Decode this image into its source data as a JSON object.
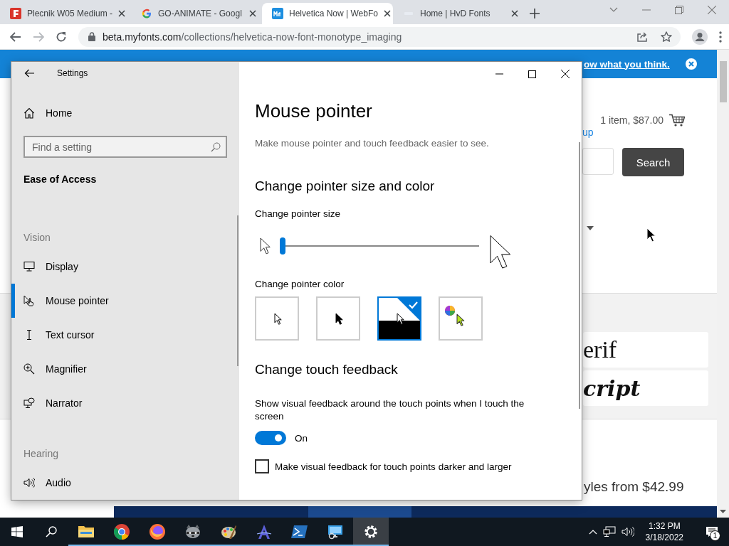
{
  "browser": {
    "tabs": [
      {
        "title": "Plecnik W05 Medium -",
        "kind": "letter-f",
        "selected": false
      },
      {
        "title": "GO-ANIMATE - Googl",
        "kind": "letter-g",
        "selected": false
      },
      {
        "title": "Helvetica Now | WebFo",
        "kind": "fonts",
        "selected": true
      },
      {
        "title": "Home | HvD Fonts",
        "kind": "blank",
        "selected": false
      }
    ],
    "address": {
      "host": "beta.myfonts.com",
      "path": "/collections/helvetica-now-font-monotype_imaging"
    }
  },
  "web_page": {
    "banner_link": "ow what you think.",
    "cart": "1 item, $87.00",
    "link": "up",
    "search_button": "Search",
    "font_cards": [
      {
        "text": "erif",
        "kind": "serif"
      },
      {
        "text": "cript",
        "kind": "script"
      }
    ],
    "price": "yles from $42.99"
  },
  "settings_window": {
    "title": "Settings",
    "nav": {
      "home": "Home",
      "search_placeholder": "Find a setting",
      "section": "Ease of Access",
      "groups": [
        {
          "heading": "Vision",
          "items": [
            {
              "label": "Display",
              "kind": "display",
              "selected": false
            },
            {
              "label": "Mouse pointer",
              "kind": "pointer",
              "selected": true
            },
            {
              "label": "Text cursor",
              "kind": "text-cursor",
              "selected": false
            },
            {
              "label": "Magnifier",
              "kind": "magnifier",
              "selected": false
            },
            {
              "label": "Narrator",
              "kind": "narrator",
              "selected": false
            }
          ]
        },
        {
          "heading": "Hearing",
          "items": [
            {
              "label": "Audio",
              "kind": "audio",
              "selected": false
            }
          ]
        }
      ]
    },
    "page": {
      "title": "Mouse pointer",
      "description": "Make mouse pointer and touch feedback easier to see.",
      "size_section": {
        "heading": "Change pointer size and color",
        "size_label": "Change pointer size",
        "size_slider": {
          "level": 0.0
        },
        "color_label": "Change pointer color",
        "color_options": [
          {
            "kind": "white",
            "selected": false
          },
          {
            "kind": "black",
            "selected": false
          },
          {
            "kind": "inverted",
            "selected": true
          },
          {
            "kind": "custom",
            "selected": false
          }
        ]
      },
      "touch_section": {
        "heading": "Change touch feedback",
        "toggle_label": "Show visual feedback around the touch points when I touch the screen",
        "toggle_on": true,
        "toggle_state": "On",
        "checkbox_label": "Make visual feedback for touch points darker and larger",
        "checkbox_checked": false
      }
    }
  },
  "taskbar": {
    "apps": [
      {
        "kind": "explorer",
        "open": true,
        "active": false
      },
      {
        "kind": "chrome",
        "open": true,
        "active": false
      },
      {
        "kind": "firefox",
        "open": true,
        "active": false
      },
      {
        "kind": "raccoon",
        "open": true,
        "active": false
      },
      {
        "kind": "paint",
        "open": true,
        "active": false
      },
      {
        "kind": "letter-a",
        "open": true,
        "active": false
      },
      {
        "kind": "powershell",
        "open": true,
        "active": false
      },
      {
        "kind": "remote",
        "open": true,
        "active": false
      },
      {
        "kind": "settings",
        "open": true,
        "active": true
      }
    ],
    "time": "1:32 PM",
    "date": "3/18/2022",
    "notification_count": "1"
  }
}
